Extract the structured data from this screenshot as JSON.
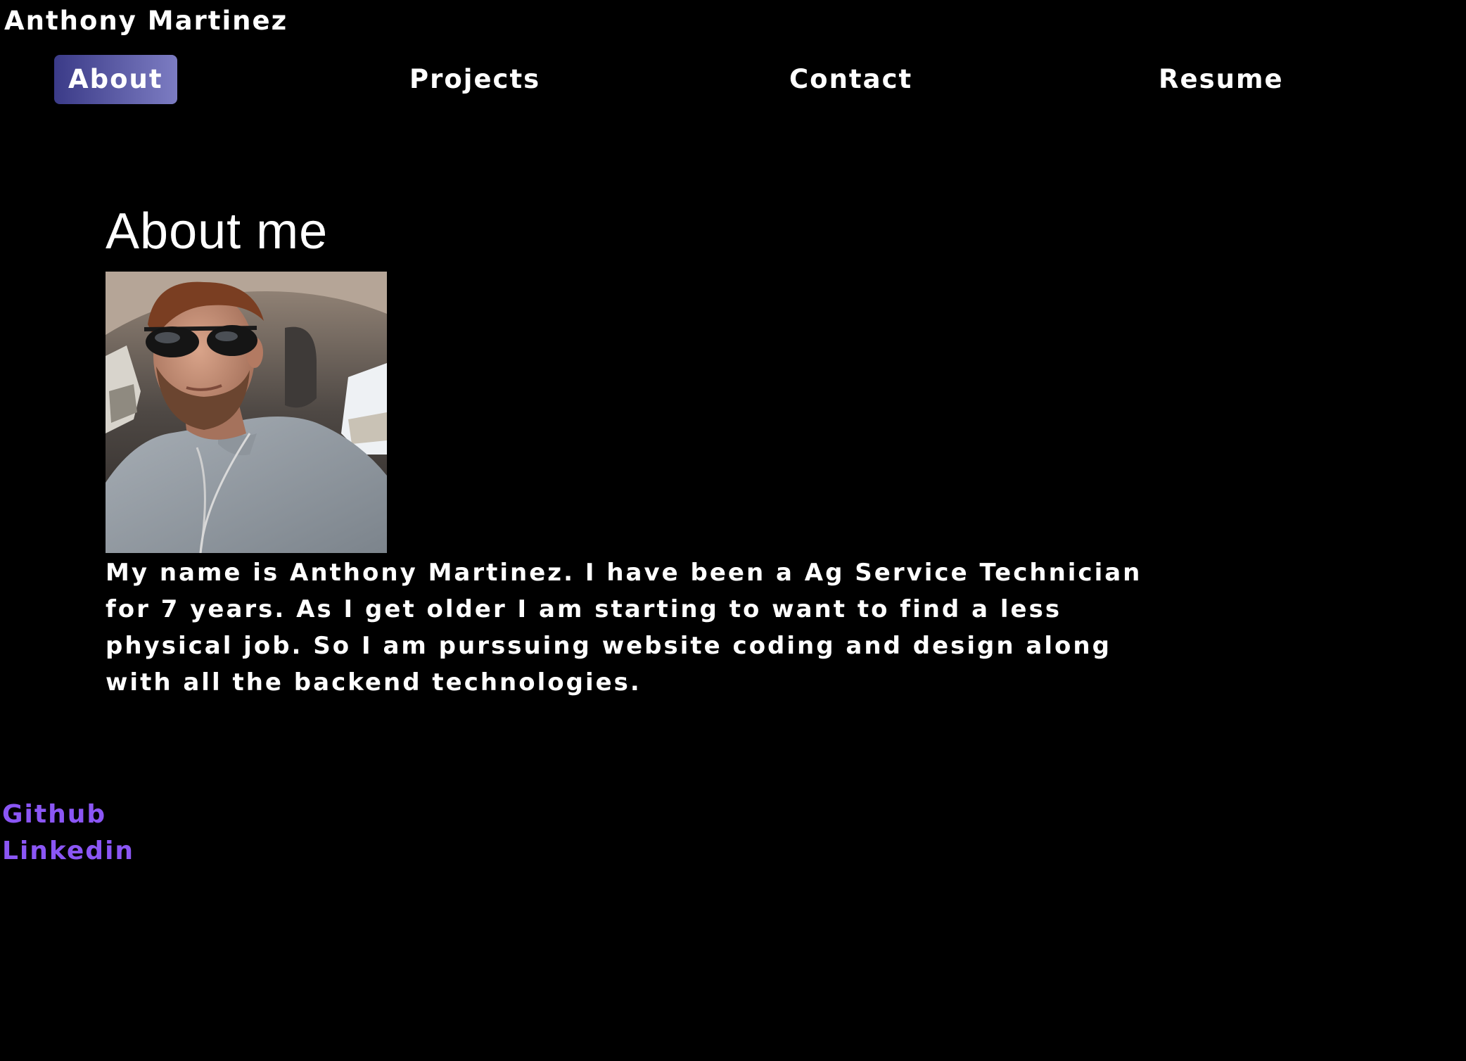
{
  "header": {
    "site_name": "Anthony Martinez"
  },
  "nav": {
    "items": [
      {
        "label": "About",
        "active": true
      },
      {
        "label": "Projects",
        "active": false
      },
      {
        "label": "Contact",
        "active": false
      },
      {
        "label": "Resume",
        "active": false
      }
    ]
  },
  "about": {
    "title": "About me",
    "photo_icon": "profile-photo",
    "bio": "My name is Anthony Martinez. I have been a Ag Service Technician for 7 years. As I get older I am starting to want to find a less physical job. So I am purssuing website coding and design along with all the backend technologies."
  },
  "footer": {
    "links": [
      {
        "label": "Github"
      },
      {
        "label": "Linkedin"
      }
    ]
  },
  "colors": {
    "background": "#000000",
    "text": "#ffffff",
    "link": "#8b56f5",
    "active_nav_start": "#3b3b88",
    "active_nav_end": "#7c7cc2"
  }
}
